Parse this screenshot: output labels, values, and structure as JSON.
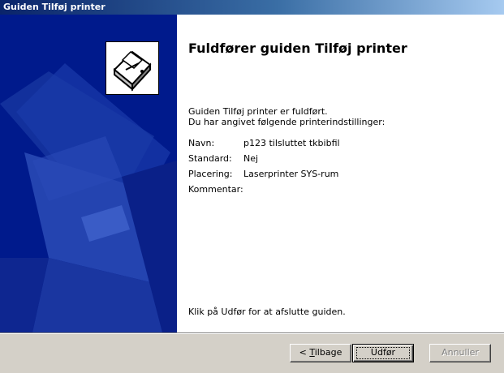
{
  "window": {
    "title": "Guiden Tilføj printer"
  },
  "main": {
    "heading": "Fuldfører guiden Tilføj printer",
    "intro_line1": "Guiden Tilføj printer er fuldført.",
    "intro_line2": "Du har angivet følgende printerindstillinger:",
    "settings": [
      {
        "label": "Navn:",
        "value": "p123 tilsluttet tkbibfil"
      },
      {
        "label": "Standard:",
        "value": "Nej"
      },
      {
        "label": "Placering:",
        "value": "Laserprinter SYS-rum"
      },
      {
        "label": "Kommentar:",
        "value": ""
      }
    ],
    "finish_note": "Klik på Udfør for at afslutte guiden."
  },
  "buttons": {
    "back_prefix": "< ",
    "back_mnemonic": "T",
    "back_rest": "ilbage",
    "finish": "Udfør",
    "cancel": "Annuller"
  },
  "icons": {
    "wizard_icon": "printer-icon"
  },
  "colors": {
    "titlebar": "#0a246a",
    "side_panel": "#001880"
  }
}
